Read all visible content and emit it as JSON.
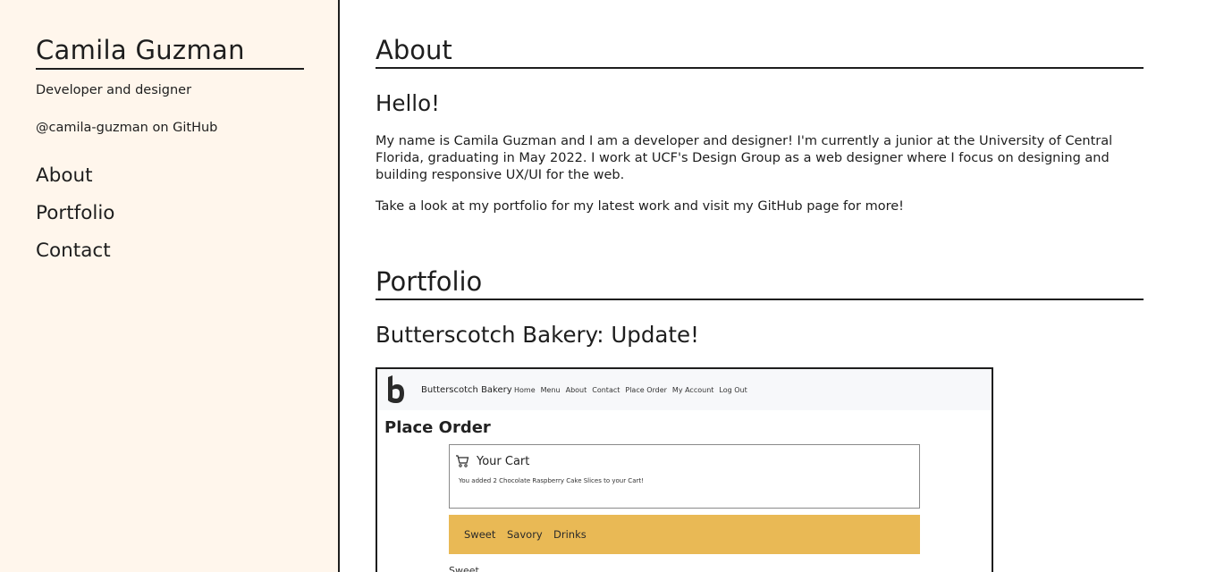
{
  "sidebar": {
    "name": "Camila Guzman",
    "tagline": "Developer and designer",
    "github": "@camila-guzman on GitHub",
    "nav": [
      "About",
      "Portfolio",
      "Contact"
    ]
  },
  "about": {
    "title": "About",
    "greeting": "Hello!",
    "paragraph1": "My name is Camila Guzman and I am a developer and designer! I'm currently a junior at the University of Central Florida, graduating in May 2022. I work at UCF's Design Group as a web designer where I focus on designing and building responsive UX/UI for the web.",
    "paragraph2": "Take a look at my portfolio for my latest work and visit my GitHub page for more!"
  },
  "portfolio": {
    "title": "Portfolio",
    "project_title": "Butterscotch Bakery: Update!",
    "screenshot": {
      "brand": "Butterscotch Bakery",
      "links": [
        "Home",
        "Menu",
        "About",
        "Contact",
        "Place Order",
        "My Account",
        "Log Out"
      ],
      "heading": "Place Order",
      "cart_title": "Your Cart",
      "cart_message": "You added 2 Chocolate Raspberry Cake Slices to your Cart!",
      "categories": [
        "Sweet",
        "Savory",
        "Drinks"
      ],
      "cut_text": "Sweet"
    }
  },
  "colors": {
    "sidebar_bg": "#fff6ec",
    "text": "#1e1e1e",
    "category_bar": "#e9b955"
  }
}
